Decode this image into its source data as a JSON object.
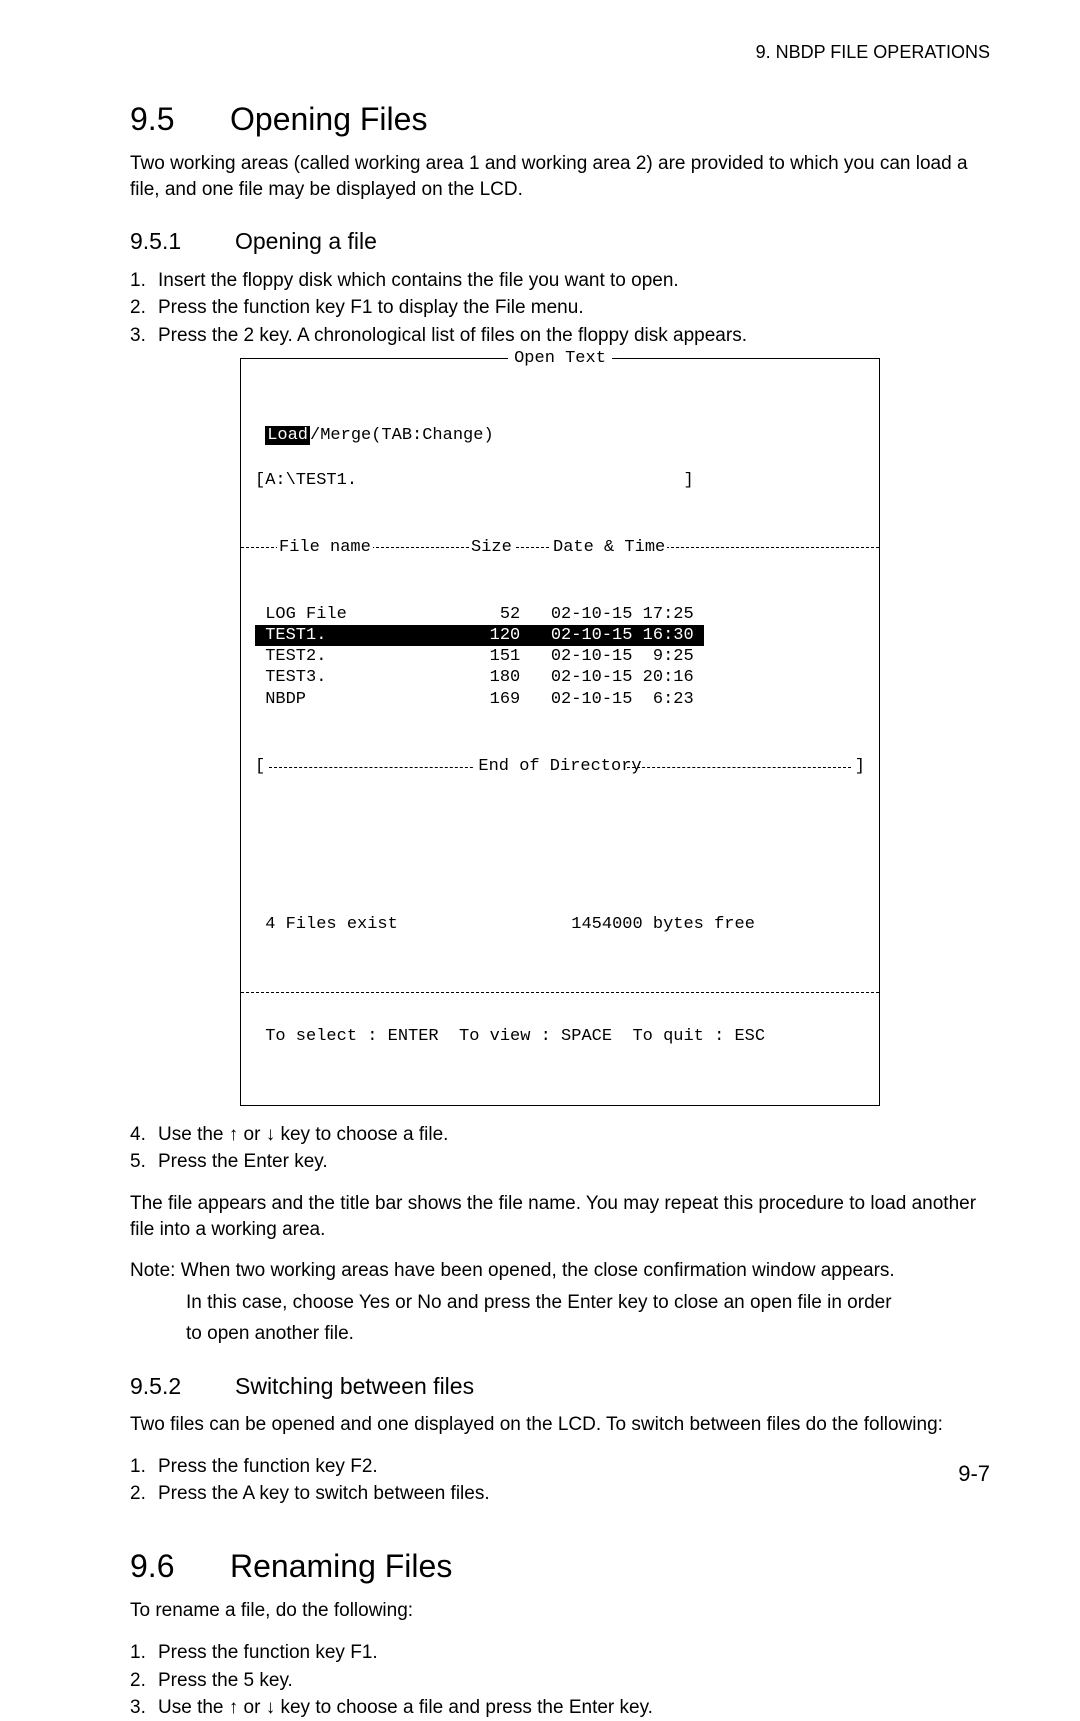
{
  "header": {
    "chapter": "9. NBDP FILE OPERATIONS"
  },
  "s95": {
    "num": "9.5",
    "title": "Opening Files",
    "intro": "Two working areas (called working area 1 and working area 2) are provided to which you can load a file, and one file may be displayed on the LCD."
  },
  "s951": {
    "num": "9.5.1",
    "title": "Opening a file",
    "steps": [
      "Insert the floppy disk which contains the file you want to open.",
      "Press the function key F1 to display the File menu.",
      "Press the 2 key. A chronological list of files on the floppy disk appears."
    ],
    "post_steps": [
      "Use the ↑ or ↓ key to choose a file.",
      "Press the Enter key."
    ],
    "after": "The file appears and the title bar shows the file name. You may repeat this procedure to load another file into a working area.",
    "note_label": "Note:",
    "note_first": "When two working areas have been opened, the close confirmation window appears.",
    "note_rest1": "In this case, choose Yes or No and press the Enter key to close an open file in order",
    "note_rest2": "to open another file."
  },
  "terminal": {
    "title": "Open Text",
    "mode_load": "Load",
    "mode_rest": "/Merge(TAB:Change)",
    "path_line": "[A:\\TEST1.                                ]",
    "hdr_file": "File name",
    "hdr_size": "Size",
    "hdr_date": "Date & Time",
    "rows": [
      {
        "name": "LOG File",
        "size": "52",
        "dt": "02-10-15 17:25",
        "sel": false
      },
      {
        "name": "TEST1.",
        "size": "120",
        "dt": "02-10-15 16:30",
        "sel": true
      },
      {
        "name": "TEST2.",
        "size": "151",
        "dt": "02-10-15  9:25",
        "sel": false
      },
      {
        "name": "TEST3.",
        "size": "180",
        "dt": "02-10-15 20:16",
        "sel": false
      },
      {
        "name": "NBDP",
        "size": "169",
        "dt": "02-10-15  6:23",
        "sel": false
      }
    ],
    "end_dir": "End of Directory",
    "status_left": "4 Files exist",
    "status_right": "1454000 bytes free",
    "footer": "To select : ENTER  To view : SPACE  To quit : ESC"
  },
  "s952": {
    "num": "9.5.2",
    "title": "Switching between files",
    "intro": "Two files can be opened and one displayed on the LCD. To switch between files do the following:",
    "steps": [
      "Press the function key F2.",
      "Press the A key to switch between files."
    ]
  },
  "s96": {
    "num": "9.6",
    "title": "Renaming Files",
    "intro": "To rename a file, do the following:",
    "steps": [
      "Press the function key F1.",
      "Press the 5 key.",
      "Use the ↑ or ↓ key to choose a file and press the Enter key."
    ]
  },
  "page_num": "9-7"
}
